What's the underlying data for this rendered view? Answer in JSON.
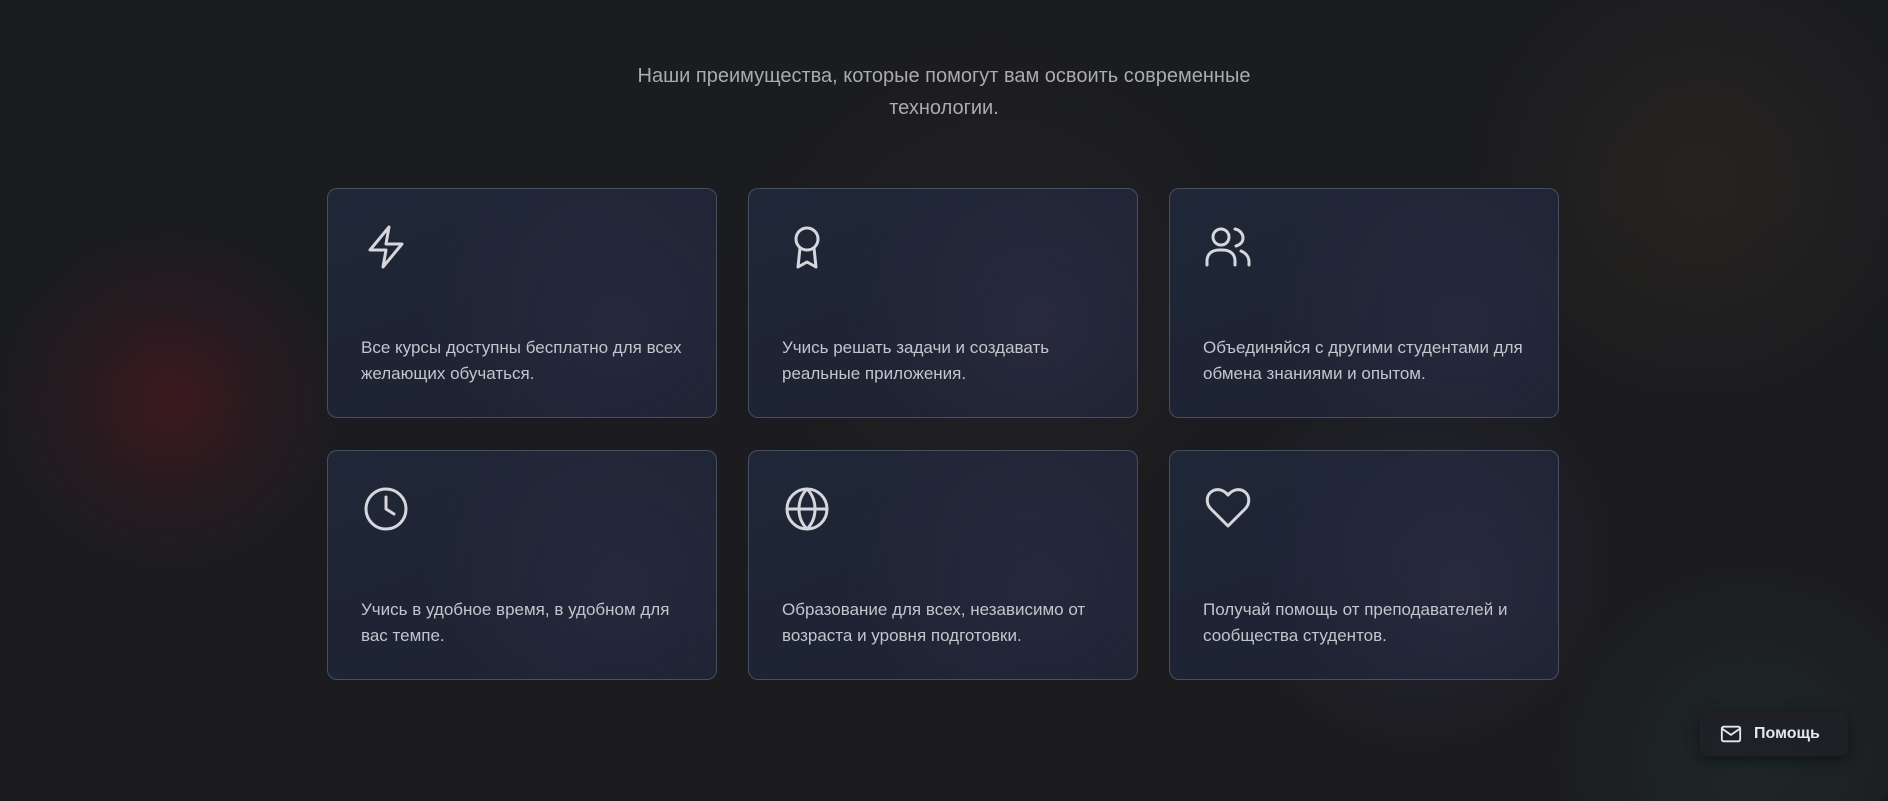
{
  "header": {
    "subtitle": "Наши преимущества, которые помогут вам освоить современные технологии."
  },
  "features": [
    {
      "icon": "lightning-icon",
      "text": "Все курсы доступны бесплатно для всех желающих обучаться."
    },
    {
      "icon": "award-icon",
      "text": "Учись решать задачи и создавать реальные приложения."
    },
    {
      "icon": "users-icon",
      "text": "Объединяйся с другими студентами для обмена знаниями и опытом."
    },
    {
      "icon": "clock-icon",
      "text": "Учись в удобное время, в удобном для вас темпе."
    },
    {
      "icon": "globe-icon",
      "text": "Образование для всех, независимо от возраста и уровня подготовки."
    },
    {
      "icon": "heart-icon",
      "text": "Получай помощь от преподавателей и сообщества студентов."
    }
  ],
  "help": {
    "label": "Помощь",
    "icon": "mail-icon"
  },
  "colors": {
    "background": "#1b1c1f",
    "card_background": "#1f2636",
    "card_border": "#5a6070",
    "text": "#c3c5cc",
    "subtitle": "#a9aab2"
  }
}
